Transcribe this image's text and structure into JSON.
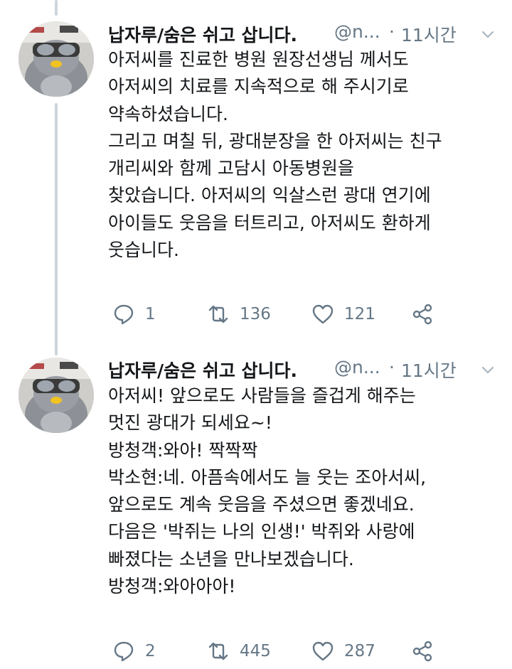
{
  "tweets": [
    {
      "display_name": "납자루/숨은 쉬고 삽니다.",
      "handle": "@n...",
      "separator": "·",
      "time": "11시간",
      "lines": [
        "아저씨를 진료한 병원 원장선생님 께서도",
        "아저씨의 치료를 지속적으로 해 주시기로",
        "약속하셨습니다.",
        "그리고 며칠 뒤, 광대분장을 한 아저씨는 친구",
        "개리씨와 함께 고담시 아동병원을",
        "찾았습니다. 아저씨의 익살스런 광대 연기에",
        "아이들도 웃음을 터트리고, 아저씨도 환하게",
        "웃습니다."
      ],
      "replies": "1",
      "retweets": "136",
      "likes": "121"
    },
    {
      "display_name": "납자루/숨은 쉬고 삽니다.",
      "handle": "@n...",
      "separator": "·",
      "time": "11시간",
      "lines": [
        "아저씨! 앞으로도 사람들을 즐겁게 해주는",
        "멋진 광대가 되세요~!",
        "방청객:와아! 짝짝짝",
        "박소현:네. 아픔속에서도 늘 웃는 조아서씨,",
        "앞으로도 계속 웃음을 주셨으면 좋겠네요.",
        "다음은 '박쥐는 나의 인생!' 박쥐와 사랑에",
        "빠졌다는 소년을 만나보겠습니다.",
        "방청객:와아아아!"
      ],
      "replies": "2",
      "retweets": "445",
      "likes": "287"
    }
  ],
  "icons": {
    "reply": "reply-icon",
    "retweet": "retweet-icon",
    "like": "heart-icon",
    "share": "share-icon",
    "chevron": "chevron-down-icon",
    "avatar": "penguin-avatar"
  },
  "colors": {
    "text": "#14171a",
    "secondary": "#657786",
    "thread_line": "#ccd6dd",
    "background": "#ffffff"
  }
}
